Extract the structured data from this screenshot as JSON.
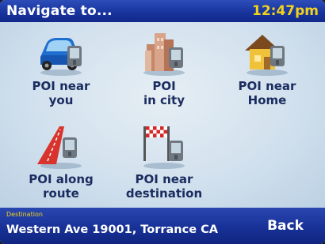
{
  "header": {
    "title": "Navigate to...",
    "clock": "12:47pm"
  },
  "menu": [
    {
      "id": "poi-near-you",
      "label": "POI near\nyou",
      "icon": "car-gps-icon"
    },
    {
      "id": "poi-in-city",
      "label": "POI\nin city",
      "icon": "city-gps-icon"
    },
    {
      "id": "poi-near-home",
      "label": "POI near\nHome",
      "icon": "home-gps-icon"
    },
    {
      "id": "poi-along-route",
      "label": "POI along\nroute",
      "icon": "route-gps-icon"
    },
    {
      "id": "poi-near-destination",
      "label": "POI near\ndestination",
      "icon": "finish-flag-gps-icon"
    }
  ],
  "footer": {
    "destination_label": "Destination",
    "destination_value": "Western Ave 19001, Torrance CA",
    "back_label": "Back"
  },
  "colors": {
    "bar_blue": "#17339c",
    "clock_yellow": "#f2d21c",
    "label_navy": "#1b2d60",
    "background": "#d2e1ee"
  }
}
